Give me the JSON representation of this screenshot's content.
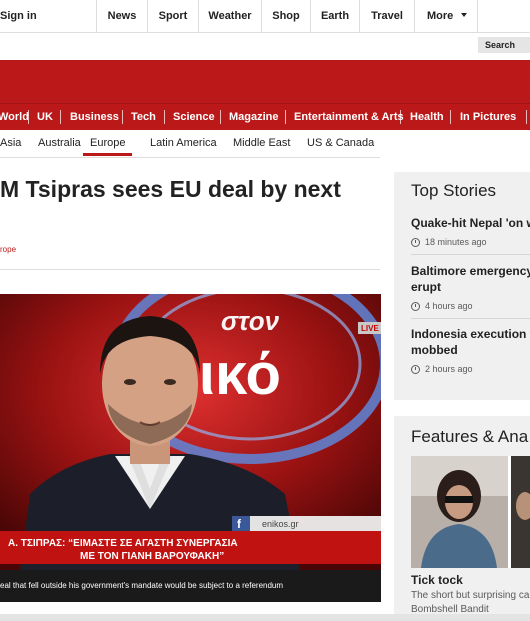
{
  "topbar": {
    "signin": "Sign in",
    "nav": [
      "News",
      "Sport",
      "Weather",
      "Shop",
      "Earth",
      "Travel",
      "More"
    ],
    "search_label": "Search"
  },
  "sections": [
    "World",
    "UK",
    "Business",
    "Tech",
    "Science",
    "Magazine",
    "Entertainment & Arts",
    "Health",
    "In Pictures"
  ],
  "regions": [
    "Asia",
    "Australia",
    "Europe",
    "Latin America",
    "Middle East",
    "US & Canada"
  ],
  "active_region": "Europe",
  "article": {
    "headline": "M Tsipras sees EU deal by next",
    "tag": "rope",
    "photo": {
      "logo_text": "στον ενικό",
      "live_label": "LIVE",
      "network": "enikos.gr",
      "ticker_line1": "Α. ΤΣΙΠΡΑΣ: “ΕΙΜΑΣΤΕ ΣΕ ΑΓΑΣΤΗ ΣΥΝΕΡΓΑΣΙΑ",
      "ticker_line2": "ΜΕ ΤΟΝ ΓΙΑΝΗ ΒΑΡΟΥΦΑΚΗ”"
    },
    "caption": "eal that fell outside his government's mandate would be subject to a referendum"
  },
  "top_stories": {
    "title": "Top Stories",
    "items": [
      {
        "title": "Quake-hit Nepal 'on w",
        "time": "18 minutes ago"
      },
      {
        "title": "Baltimore emergency",
        "title2": "erupt",
        "time": "4 hours ago"
      },
      {
        "title": "Indonesia execution t",
        "title2": "mobbed",
        "time": "2 hours ago"
      }
    ]
  },
  "features": {
    "title": "Features & Ana",
    "item_title": "Tick tock",
    "item_sub1": "The short but surprising ca",
    "item_sub2": "Bombshell Bandit"
  },
  "colors": {
    "brand_red": "#bb1919",
    "panel_bg": "#f0f0f0"
  }
}
